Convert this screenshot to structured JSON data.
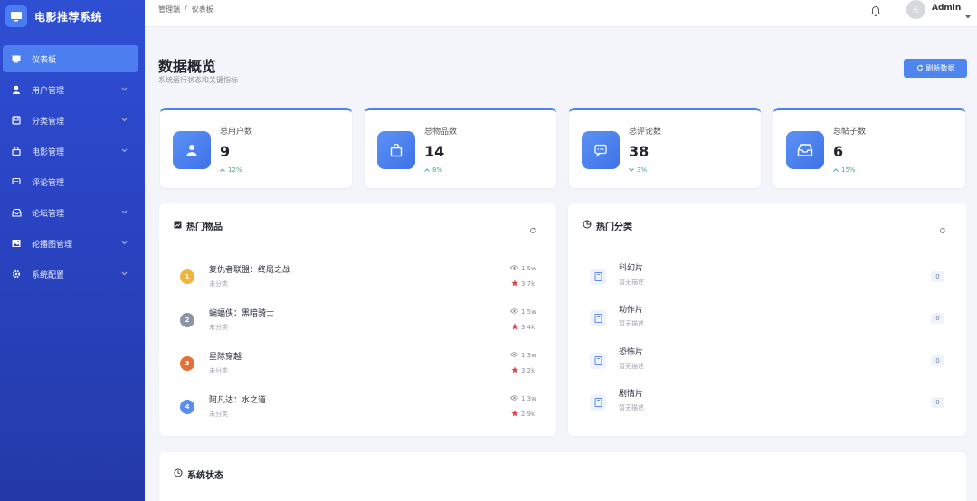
{
  "app": {
    "title": "电影推荐系统"
  },
  "sidebar": {
    "items": [
      {
        "label": "仪表板",
        "icon": "monitor-icon",
        "active": true,
        "has_children": false
      },
      {
        "label": "用户管理",
        "icon": "user-icon",
        "active": false,
        "has_children": true
      },
      {
        "label": "分类管理",
        "icon": "folder-icon",
        "active": false,
        "has_children": true
      },
      {
        "label": "电影管理",
        "icon": "bag-icon",
        "active": false,
        "has_children": true
      },
      {
        "label": "评论管理",
        "icon": "comment-icon",
        "active": false,
        "has_children": false
      },
      {
        "label": "论坛管理",
        "icon": "inbox-icon",
        "active": false,
        "has_children": true
      },
      {
        "label": "轮播图管理",
        "icon": "image-icon",
        "active": false,
        "has_children": true
      },
      {
        "label": "系统配置",
        "icon": "gear-icon",
        "active": false,
        "has_children": true
      }
    ]
  },
  "header": {
    "breadcrumb": [
      "管理端",
      "/",
      "仪表板"
    ],
    "avatar_text": "头",
    "user_name": "Admin"
  },
  "page": {
    "title": "数据概览",
    "subtitle": "系统运行状态和关键指标",
    "refresh_label": "刷新数据"
  },
  "stats": [
    {
      "label": "总用户数",
      "value": "9",
      "trend": "12%",
      "icon": "user-icon"
    },
    {
      "label": "总物品数",
      "value": "14",
      "trend": "8%",
      "icon": "bag-icon"
    },
    {
      "label": "总评论数",
      "value": "38",
      "trend": "3%",
      "icon": "comment-icon"
    },
    {
      "label": "总帖子数",
      "value": "6",
      "trend": "15%",
      "icon": "inbox-icon"
    }
  ],
  "hot_items": {
    "title": "热门物品",
    "items": [
      {
        "rank": "1",
        "title": "复仇者联盟：终局之战",
        "category": "未分类",
        "views": "1.5w",
        "likes": "3.7k",
        "rank_color": "#f0b43c"
      },
      {
        "rank": "2",
        "title": "蝙蝠侠：黑暗骑士",
        "category": "未分类",
        "views": "1.5w",
        "likes": "3.4k",
        "rank_color": "#8a94a6"
      },
      {
        "rank": "3",
        "title": "星际穿越",
        "category": "未分类",
        "views": "1.3w",
        "likes": "3.2k",
        "rank_color": "#e2703a"
      },
      {
        "rank": "4",
        "title": "阿凡达：水之道",
        "category": "未分类",
        "views": "1.3w",
        "likes": "2.9k",
        "rank_color": "#5b8def"
      }
    ]
  },
  "hot_categories": {
    "title": "热门分类",
    "items": [
      {
        "title": "科幻片",
        "desc": "暂无描述",
        "count": "0"
      },
      {
        "title": "动作片",
        "desc": "暂无描述",
        "count": "0"
      },
      {
        "title": "恐怖片",
        "desc": "暂无描述",
        "count": "0"
      },
      {
        "title": "剧情片",
        "desc": "暂无描述",
        "count": "0"
      }
    ]
  },
  "system_status": {
    "title": "系统状态"
  },
  "colors": {
    "accent": "#4d7ef0",
    "sidebar": "#2a44c4",
    "trend_up": "#3db37a",
    "like": "#e0474c"
  }
}
